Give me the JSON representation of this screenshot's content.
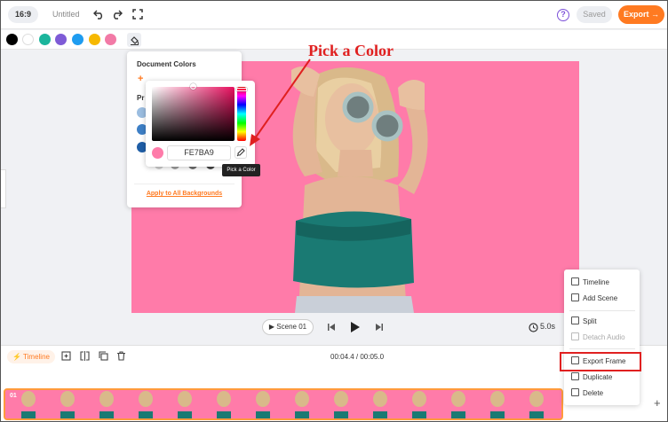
{
  "topbar": {
    "ratio": "16:9",
    "title": "Untitled",
    "saved": "Saved",
    "export": "Export →"
  },
  "colors": {
    "swatches": [
      "#000000",
      "#ffffff",
      "#1bb59c",
      "#7e5bd6",
      "#1e9cf0",
      "#f6b800",
      "#f27aa6"
    ],
    "accent": "#ff7a21",
    "canvas_bg": "#ff7ba9"
  },
  "doc_panel": {
    "title": "Document Colors",
    "add": "+",
    "presets_label": "Pr",
    "apply": "Apply to All Backgrounds"
  },
  "picker": {
    "hex": "FE7BA9",
    "tooltip": "Pick a Color"
  },
  "annotation": "Pick a Color",
  "player": {
    "scene": "Scene 01",
    "duration": "5.0s"
  },
  "timeline": {
    "tab": "Timeline",
    "time": "00:04.4 / 00:05.0",
    "track_number": "01",
    "add": "+"
  },
  "context_menu": {
    "items": [
      {
        "label": "Timeline",
        "icon": "timeline-icon",
        "enabled": true
      },
      {
        "label": "Add Scene",
        "icon": "add-scene-icon",
        "enabled": true
      },
      {
        "label": "Split",
        "icon": "split-icon",
        "enabled": true
      },
      {
        "label": "Detach Audio",
        "icon": "detach-audio-icon",
        "enabled": false
      },
      {
        "label": "Export Frame",
        "icon": "export-frame-icon",
        "enabled": true
      },
      {
        "label": "Duplicate",
        "icon": "duplicate-icon",
        "enabled": true
      },
      {
        "label": "Delete",
        "icon": "trash-icon",
        "enabled": true
      }
    ]
  }
}
